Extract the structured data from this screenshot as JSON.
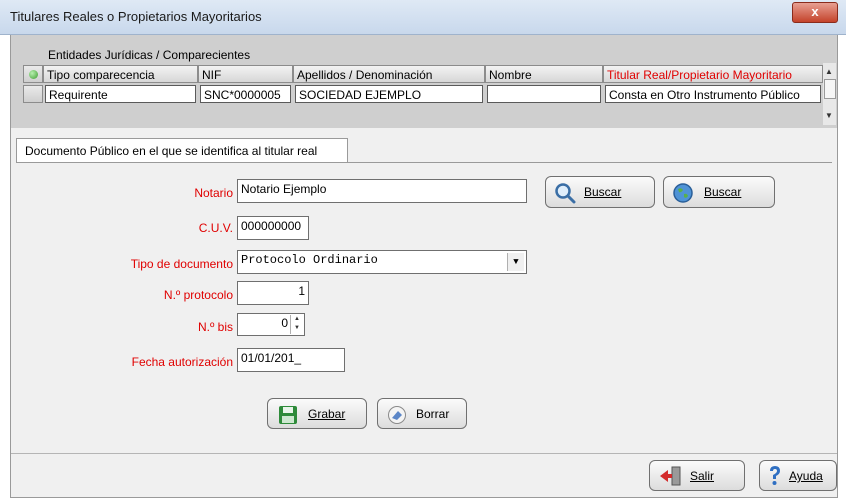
{
  "window": {
    "title": "Titulares Reales o Propietarios Mayoritarios",
    "close_label": "x"
  },
  "grid": {
    "caption": "Entidades Jurídicas / Comparecientes",
    "columns": [
      "Tipo comparecencia",
      "NIF",
      "Apellidos / Denominación",
      "Nombre",
      "Titular Real/Propietario Mayoritario"
    ],
    "rows": [
      [
        "Requirente",
        "SNC*0000005",
        "SOCIEDAD EJEMPLO",
        "",
        "Consta en Otro Instrumento Público"
      ]
    ]
  },
  "tab": {
    "label": "Documento Público en el que se identifica al titular real"
  },
  "form": {
    "notario_label": "Notario",
    "notario_value": "Notario Ejemplo",
    "cuv_label": "C.U.V.",
    "cuv_value": "000000000",
    "tipo_doc_label": "Tipo de documento",
    "tipo_doc_value": "Protocolo Ordinario",
    "protocolo_label": "N.º protocolo",
    "protocolo_value": "1",
    "bis_label": "N.º bis",
    "bis_value": "0",
    "fecha_label": "Fecha autorización",
    "fecha_value": "01/01/201_"
  },
  "buttons": {
    "buscar1": "Buscar",
    "buscar2": "Buscar",
    "grabar": "Grabar",
    "borrar": "Borrar",
    "salir": "Salir",
    "ayuda": "Ayuda"
  },
  "colors": {
    "required_label": "#e00000",
    "titlebar": "#c8d8ec",
    "close": "#c4432b"
  },
  "icons": [
    "magnifier-icon",
    "globe-icon",
    "save-icon",
    "eraser-icon",
    "exit-door-icon",
    "help-icon"
  ]
}
